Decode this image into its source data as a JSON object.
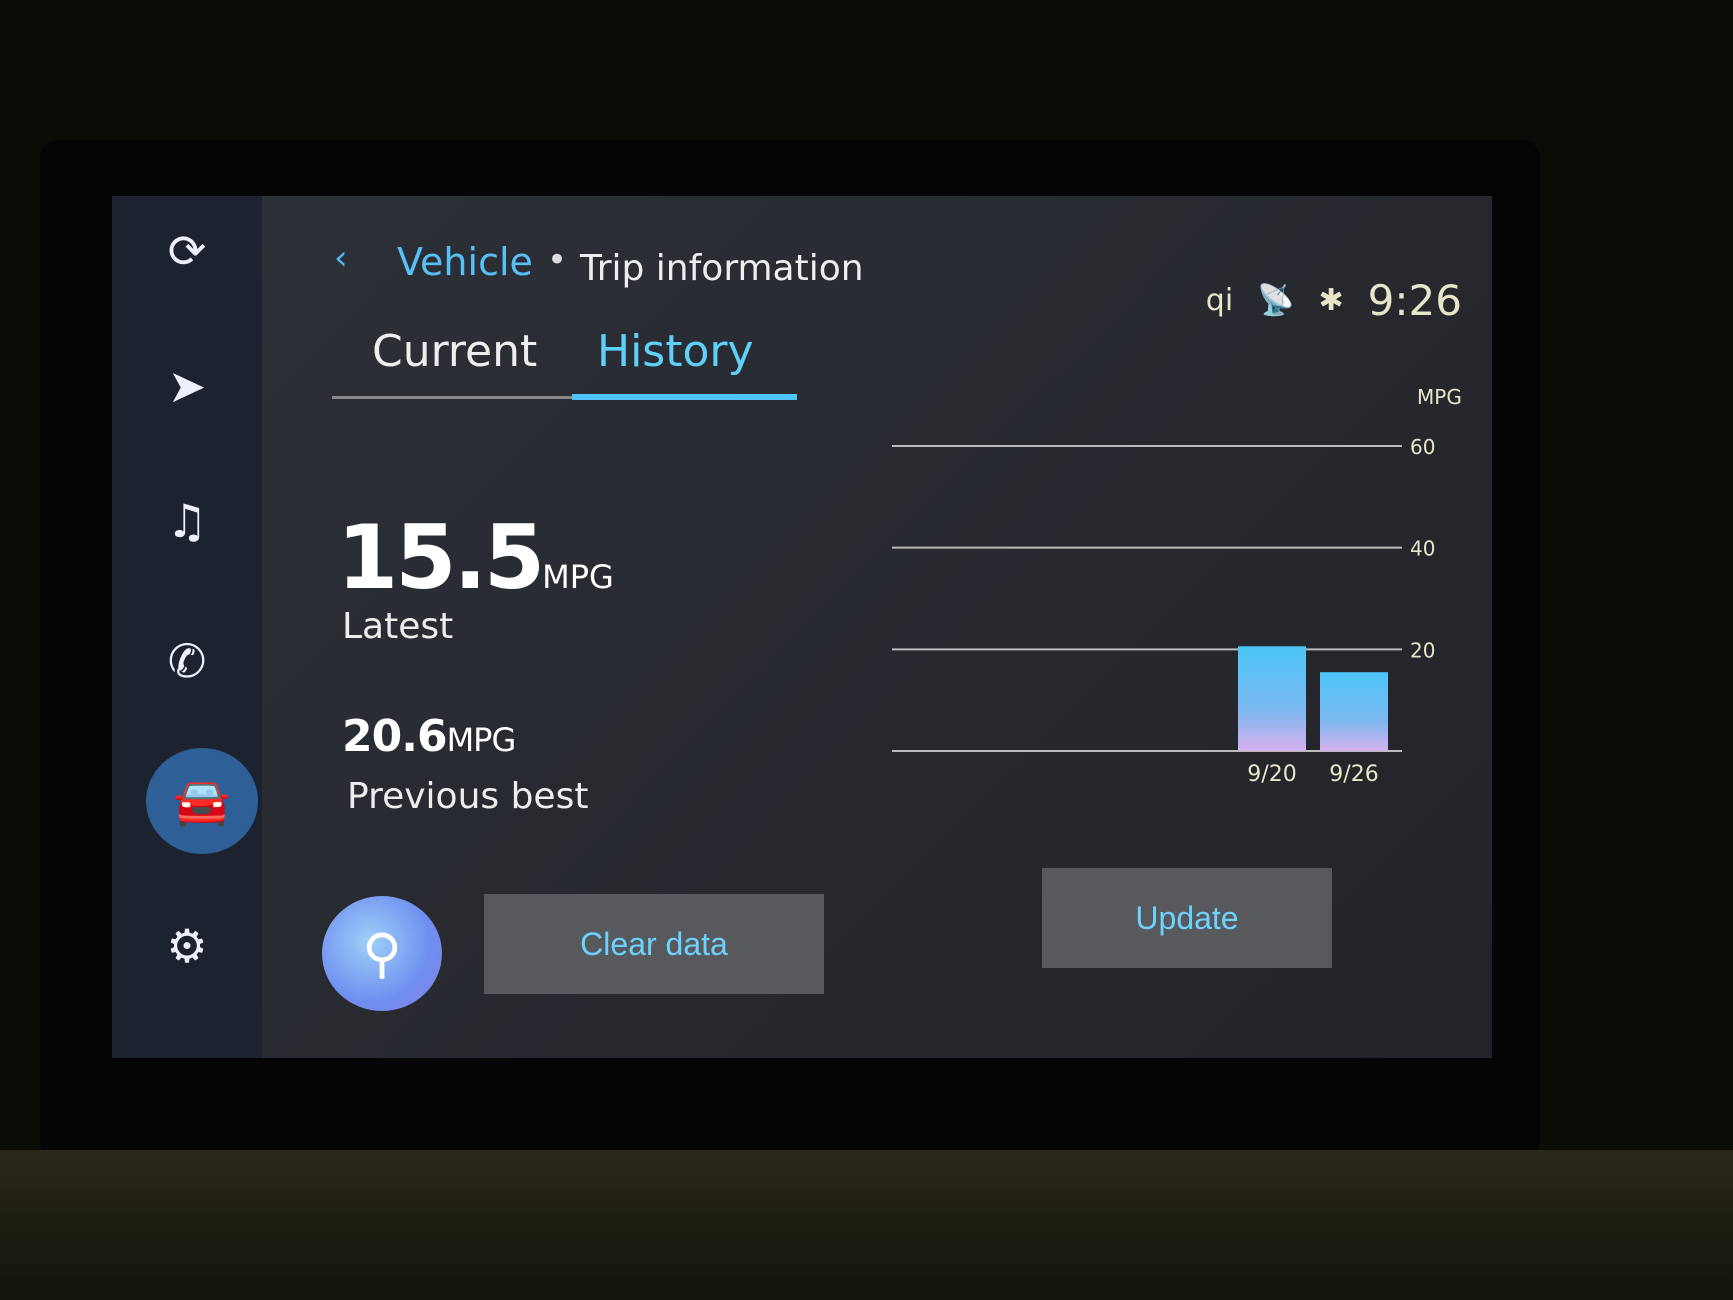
{
  "sidebar": {
    "items": [
      {
        "icon": "carplay-icon",
        "glyph": "⟳"
      },
      {
        "icon": "navigation-icon",
        "glyph": "➤"
      },
      {
        "icon": "music-icon",
        "glyph": "♫"
      },
      {
        "icon": "phone-icon",
        "glyph": "✆"
      },
      {
        "icon": "car-icon",
        "glyph": "🚘",
        "active": true
      },
      {
        "icon": "gear-icon",
        "glyph": "⚙"
      }
    ]
  },
  "header": {
    "back_glyph": "‹",
    "breadcrumb": [
      "Vehicle",
      "Trip information"
    ],
    "separator": "•"
  },
  "status": {
    "icons": [
      "wireless-charging-icon",
      "connected-services-icon",
      "bluetooth-icon"
    ],
    "glyphs": [
      "qi",
      "📡",
      "✱"
    ],
    "time": "9:26"
  },
  "tabs": [
    {
      "label": "Current"
    },
    {
      "label": "History",
      "selected": true
    }
  ],
  "latest": {
    "value": "15.5",
    "unit": "MPG",
    "label": "Latest"
  },
  "best": {
    "value": "20.6",
    "unit": "MPG",
    "label": "Previous best"
  },
  "buttons": {
    "search_glyph": "⚲",
    "clear": "Clear data",
    "update": "Update"
  },
  "colors": {
    "accent": "#4fc4f7",
    "active_nav": "#2e5f96"
  },
  "chart_data": {
    "type": "bar",
    "ylabel": "MPG",
    "ylim": [
      0,
      60
    ],
    "yticks": [
      20,
      40,
      60
    ],
    "categories": [
      "9/20",
      "9/26"
    ],
    "values": [
      20.6,
      15.5
    ],
    "grid": true
  }
}
